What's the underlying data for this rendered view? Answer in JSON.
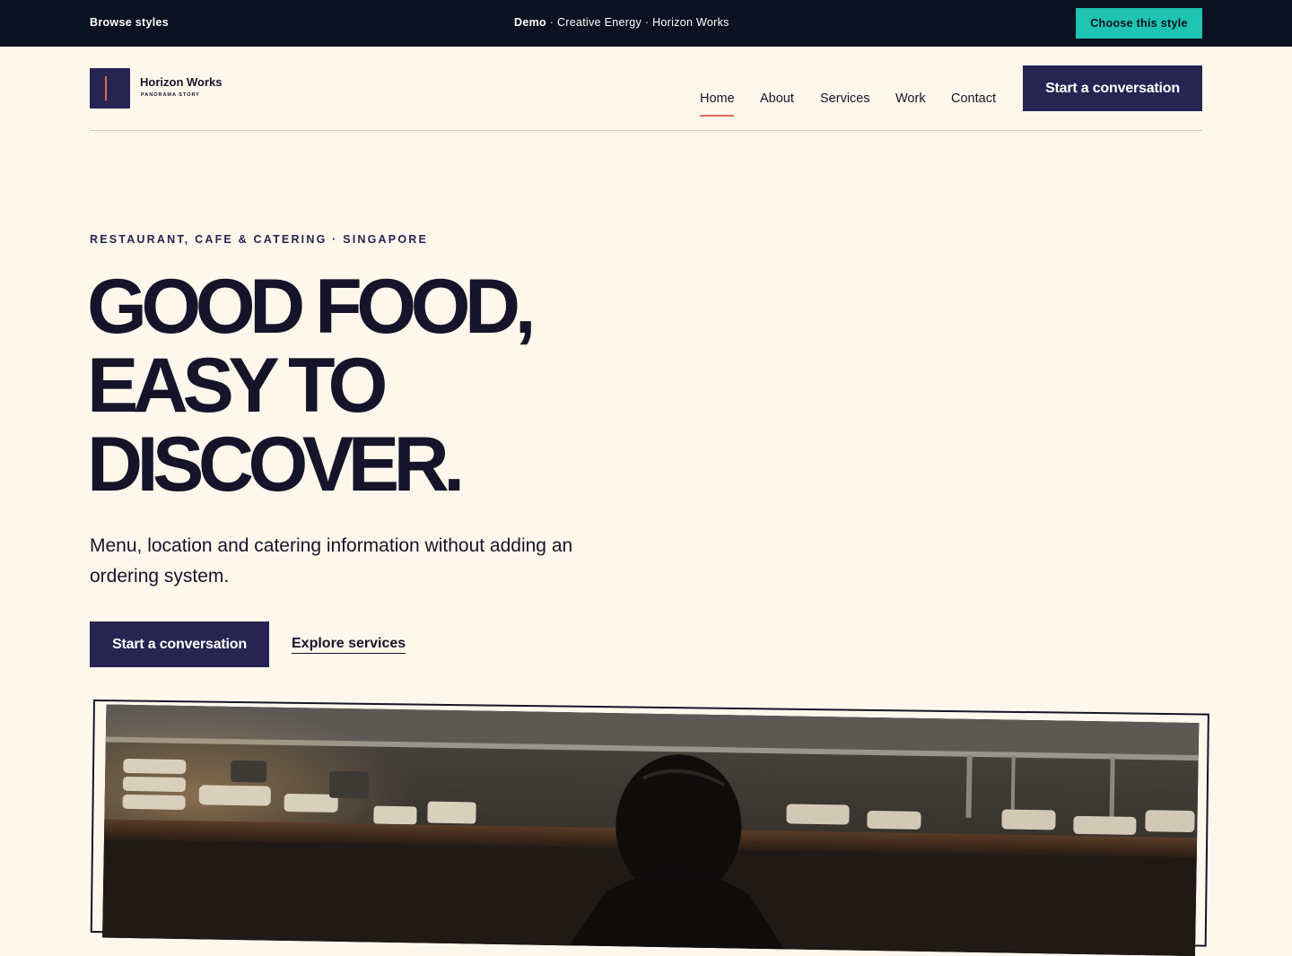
{
  "topbar": {
    "browse": "Browse styles",
    "demo_label": "Demo",
    "demo_detail": " · Creative Energy · Horizon Works",
    "choose": "Choose this style"
  },
  "brand": {
    "name": "Horizon Works",
    "tagline": "PANORAMA STORY"
  },
  "nav": {
    "items": [
      "Home",
      "About",
      "Services",
      "Work",
      "Contact"
    ],
    "active": "Home",
    "cta": "Start a conversation"
  },
  "hero": {
    "eyebrow": "RESTAURANT, CAFE & CATERING · SINGAPORE",
    "headline": [
      "GOOD FOOD,",
      "EASY TO",
      "DISCOVER."
    ],
    "lead": "Menu, location and catering information without adding an ordering system.",
    "primary_cta": "Start a conversation",
    "secondary_cta": "Explore services"
  },
  "colors": {
    "page_bg": "#fef8ec",
    "topbar_bg": "#0a1120",
    "accent_teal": "#1ec3b1",
    "brand_navy": "#272452",
    "accent_coral": "#e46a55",
    "ink": "#16142a"
  }
}
